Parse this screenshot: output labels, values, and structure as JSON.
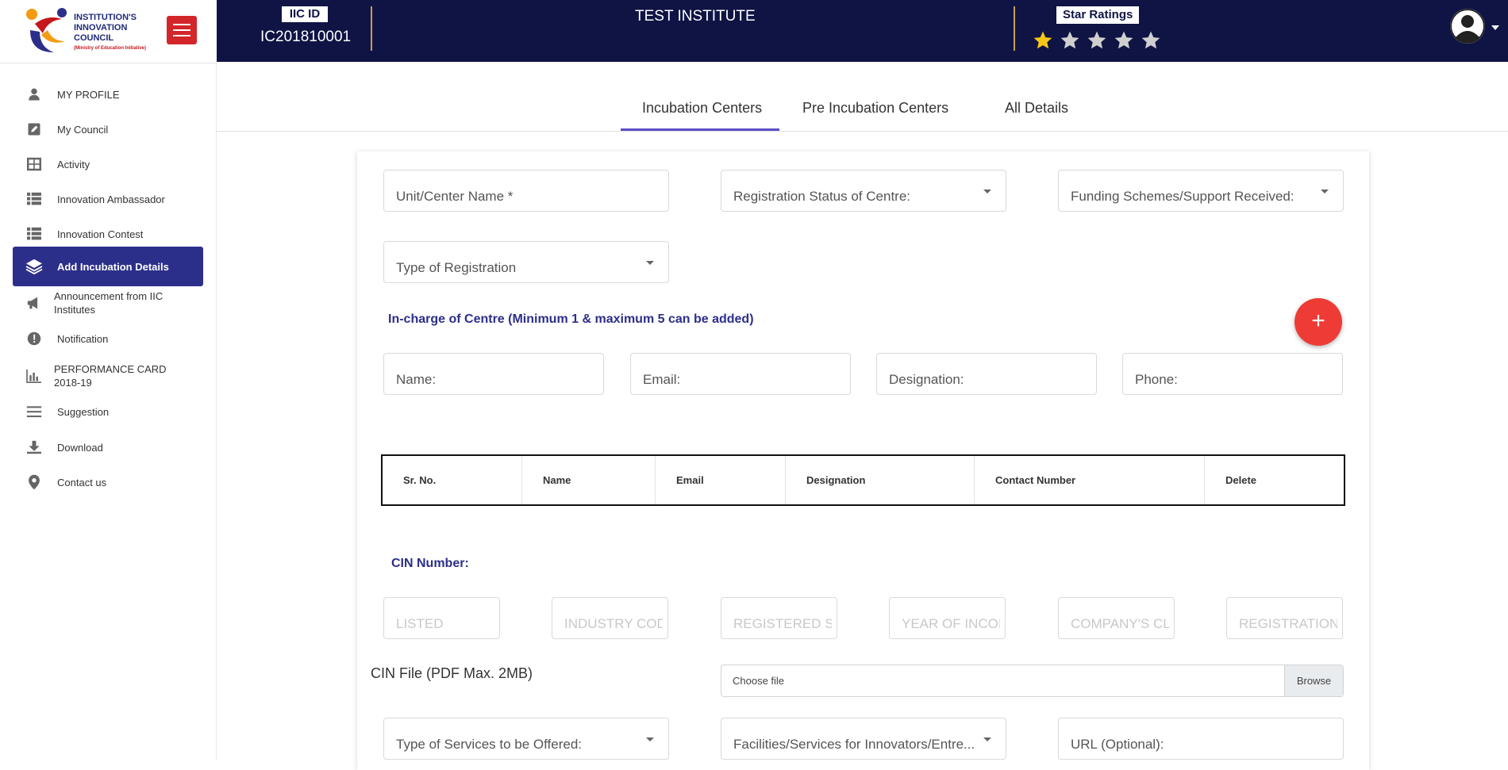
{
  "logo": {
    "line1": "INSTITUTION'S",
    "line2": "INNOVATION",
    "line3": "COUNCIL",
    "sub": "(Ministry of Education Initiative)"
  },
  "header": {
    "iic_label": "IIC ID",
    "iic_value": "IC201810001",
    "institute_name": "TEST INSTITUTE",
    "star_label": "Star Ratings",
    "stars_filled": 1,
    "stars_total": 5,
    "star_colors": {
      "filled": "#f5c518",
      "empty": "#cfcfcf"
    }
  },
  "sidebar": {
    "items": [
      {
        "label": "MY PROFILE",
        "icon": "person-icon"
      },
      {
        "label": "My Council",
        "icon": "edit-icon"
      },
      {
        "label": "Activity",
        "icon": "grid-icon"
      },
      {
        "label": "Innovation Ambassador",
        "icon": "list-icon"
      },
      {
        "label": "Innovation Contest",
        "icon": "list-icon"
      },
      {
        "label": "Add Incubation Details",
        "icon": "layers-icon",
        "active": true
      },
      {
        "label": "Announcement from IIC Institutes",
        "icon": "megaphone-icon"
      },
      {
        "label": "Notification",
        "icon": "alert-icon"
      },
      {
        "label": "PERFORMANCE CARD 2018-19",
        "icon": "bar-chart-icon"
      },
      {
        "label": "Suggestion",
        "icon": "menu-lines-icon"
      },
      {
        "label": "Download",
        "icon": "download-icon"
      },
      {
        "label": "Contact us",
        "icon": "location-pin-icon"
      }
    ]
  },
  "tabs": [
    {
      "label": "Incubation Centers",
      "active": true
    },
    {
      "label": "Pre Incubation Centers"
    },
    {
      "label": "All Details"
    }
  ],
  "form": {
    "unit_name": "Unit/Center Name *",
    "registration_status": "Registration Status of Centre:",
    "funding_schemes": "Funding Schemes/Support Received:",
    "type_of_registration": "Type of Registration",
    "incharge_heading": "In-charge of Centre (Minimum 1 & maximum 5 can be added)",
    "incharge_name": "Name:",
    "incharge_email": "Email:",
    "incharge_designation": "Designation:",
    "incharge_phone": "Phone:",
    "add_button": "+",
    "table_headers": [
      "Sr. No.",
      "Name",
      "Email",
      "Designation",
      "Contact Number",
      "Delete"
    ],
    "cin_heading": "CIN Number:",
    "cin_fields": [
      "LISTED",
      "INDUSTRY COD",
      "REGISTERED ST",
      "YEAR OF INCOI",
      "COMPANY'S CL",
      "REGISTRATION"
    ],
    "cin_file_label": "CIN File (PDF Max. 2MB)",
    "file_placeholder": "Choose file",
    "browse_label": "Browse",
    "services_offered": "Type of Services to be Offered:",
    "facilities": "Facilities/Services for Innovators/Entre...",
    "url_optional": "URL (Optional):"
  },
  "colors": {
    "topbar": "#0f1445",
    "accent": "#2c2f8a",
    "menu_button": "#d3262a",
    "fab": "#ef3b36",
    "tab_underline": "#5a4fc7"
  }
}
